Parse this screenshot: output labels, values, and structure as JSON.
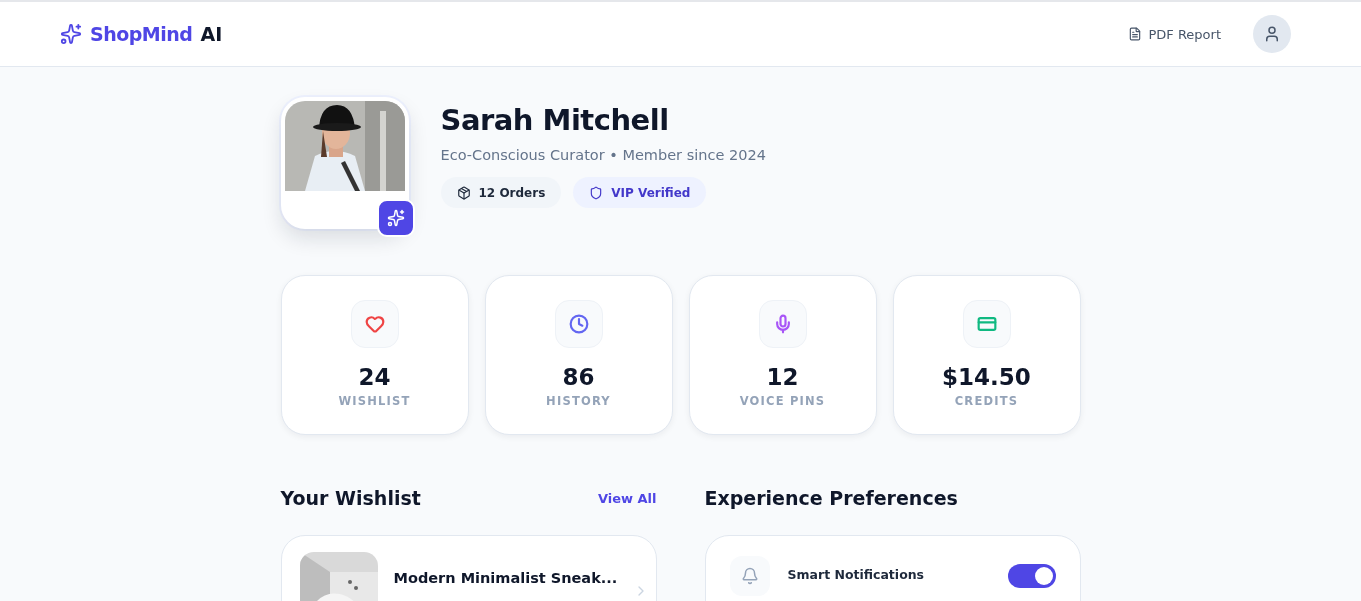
{
  "header": {
    "brand": {
      "name": "ShopMind",
      "suffix": "AI"
    },
    "actions": [
      {
        "label": "PDF Report"
      }
    ]
  },
  "profile": {
    "name": "Sarah Mitchell",
    "subtitle": "Eco-Conscious Curator • Member since 2024",
    "badges": [
      {
        "kind": "orders",
        "label": "12 Orders"
      },
      {
        "kind": "verified",
        "label": "VIP Verified"
      }
    ]
  },
  "stats": [
    {
      "kind": "heart",
      "value": "24",
      "label": "WISHLIST",
      "color": "#ef4444"
    },
    {
      "kind": "clock",
      "value": "86",
      "label": "HISTORY",
      "color": "#6366f1"
    },
    {
      "kind": "mic",
      "value": "12",
      "label": "VOICE PINS",
      "color": "#a855f7"
    },
    {
      "kind": "card",
      "value": "$14.50",
      "label": "CREDITS",
      "color": "#10b981"
    }
  ],
  "wishlist": {
    "title": "Your Wishlist",
    "link": "View All",
    "items": [
      {
        "name": "Modern Minimalist Sneak..."
      }
    ]
  },
  "preferences": {
    "title": "Experience Preferences",
    "items": [
      {
        "kind": "bell",
        "label": "Smart Notifications",
        "on": true
      }
    ]
  }
}
